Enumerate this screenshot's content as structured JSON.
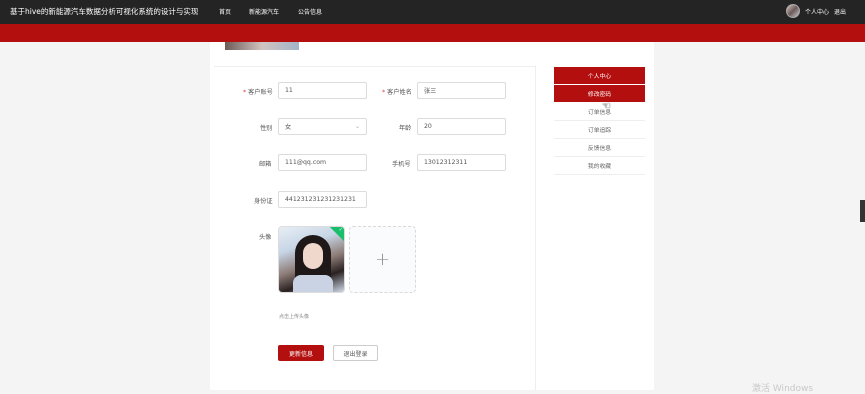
{
  "header": {
    "site_title": "基于hive的新能源汽车数据分析可视化系统的设计与实现",
    "nav": [
      "首页",
      "新能源汽车",
      "公告信息"
    ],
    "user_center": "个人中心",
    "logout": "退出"
  },
  "form": {
    "account_label": "客户账号",
    "account_value": "11",
    "name_label": "客户姓名",
    "name_value": "张三",
    "gender_label": "性别",
    "gender_value": "女",
    "age_label": "年龄",
    "age_value": "20",
    "email_label": "邮箱",
    "email_value": "111@qq.com",
    "phone_label": "手机号",
    "phone_value": "13012312311",
    "id_label": "身份证",
    "id_value": "441231231231231231",
    "avatar_label": "头像",
    "upload_hint": "点击上传头像",
    "required_mark": "*",
    "plus": "+"
  },
  "buttons": {
    "update": "更新信息",
    "logout": "退出登录"
  },
  "sidebar": {
    "items": [
      "个人中心",
      "修改密码",
      "订单信息",
      "订单追踪",
      "反馈信息",
      "我的收藏"
    ],
    "active": [
      0,
      1
    ]
  },
  "watermark": "激活 Windows"
}
